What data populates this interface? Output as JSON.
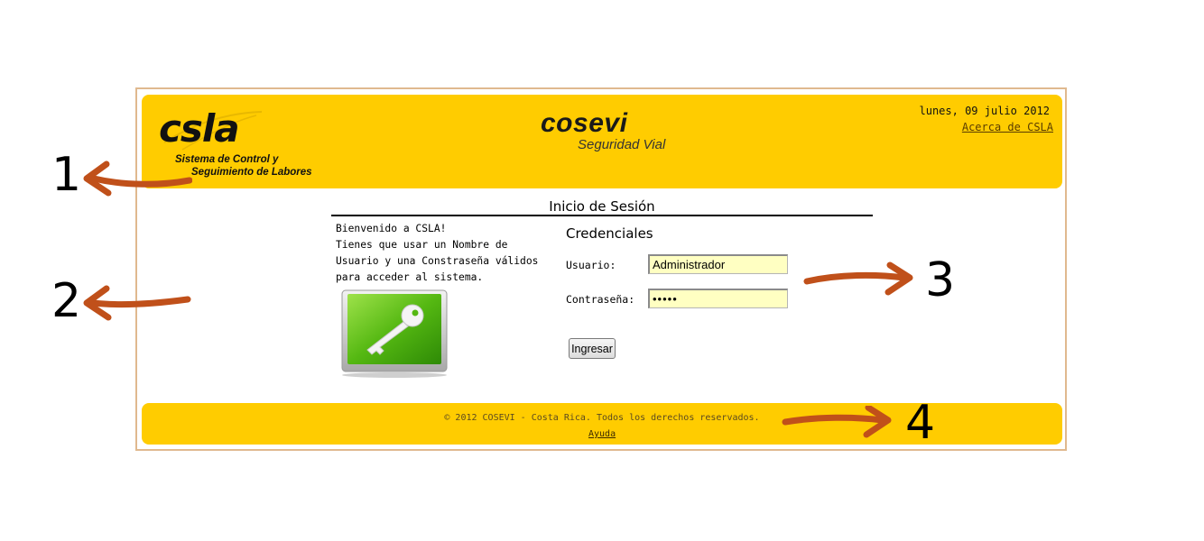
{
  "header": {
    "csla_logo_text": "csla",
    "csla_subtitle_line1": "Sistema de Control y",
    "csla_subtitle_line2": "Seguimiento de Labores",
    "cosevi_logo_text": "cosevi",
    "cosevi_subtitle": "Seguridad Vial",
    "date": "lunes, 09 julio 2012",
    "about_link": "Acerca de CSLA"
  },
  "main": {
    "title": "Inicio de Sesión",
    "welcome_line1": "Bienvenido a CSLA!",
    "welcome_text": "Tienes que usar un Nombre de Usuario y una Constraseña válidos para acceder al sistema.",
    "key_icon": "key-icon"
  },
  "credentials": {
    "title": "Credenciales",
    "user_label": "Usuario:",
    "user_value": "Administrador",
    "password_label": "Contraseña:",
    "password_value": "•••••",
    "submit_label": "Ingresar"
  },
  "footer": {
    "copyright": "© 2012 COSEVI - Costa Rica. Todos los derechos reservados.",
    "help_link": "Ayuda"
  },
  "annotations": [
    "1",
    "2",
    "3",
    "4"
  ],
  "colors": {
    "brand_yellow": "#ffcc00",
    "arrow": "#c0501a",
    "input_bg": "#ffffc2",
    "frame_border": "#e0b98f"
  }
}
